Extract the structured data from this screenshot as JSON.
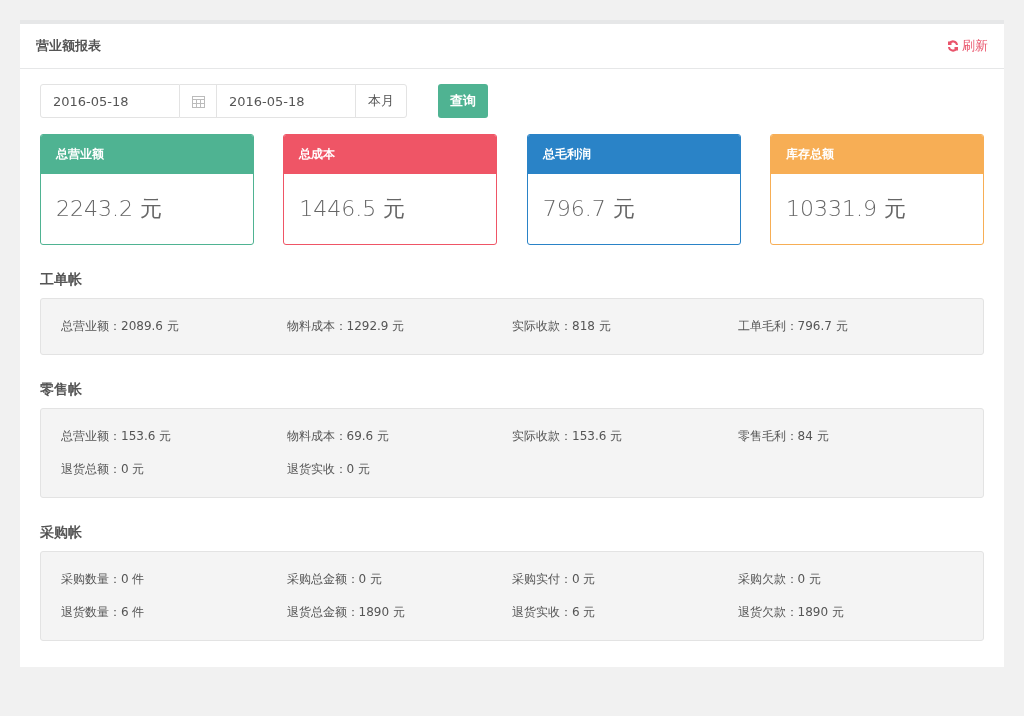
{
  "panel": {
    "title": "营业额报表",
    "refresh": "刷新"
  },
  "filter": {
    "start_date": "2016-05-18",
    "end_date": "2016-05-18",
    "range": "本月",
    "query": "查询"
  },
  "cards": [
    {
      "title": "总营业额",
      "value": "2243.2 元",
      "color": "#4fb392"
    },
    {
      "title": "总成本",
      "value": "1446.5 元",
      "color": "#ef5566"
    },
    {
      "title": "总毛利润",
      "value": "796.7 元",
      "color": "#2a83c7"
    },
    {
      "title": "库存总额",
      "value": "10331.9 元",
      "color": "#f7ae55"
    }
  ],
  "sections": [
    {
      "title": "工单帐",
      "items": [
        "总营业额：2089.6 元",
        "物料成本：1292.9 元",
        "实际收款：818 元",
        "工单毛利：796.7 元"
      ]
    },
    {
      "title": "零售帐",
      "items": [
        "总营业额：153.6 元",
        "物料成本：69.6 元",
        "实际收款：153.6 元",
        "零售毛利：84 元",
        "退货总额：0 元",
        "退货实收：0 元"
      ]
    },
    {
      "title": "采购帐",
      "items": [
        "采购数量：0 件",
        "采购总金额：0 元",
        "采购实付：0 元",
        "采购欠款：0 元",
        "退货数量：6 件",
        "退货总金额：1890 元",
        "退货实收：6 元",
        "退货欠款：1890 元"
      ]
    }
  ]
}
